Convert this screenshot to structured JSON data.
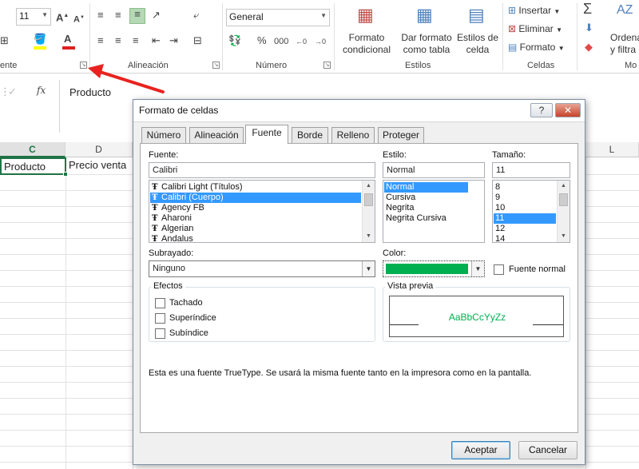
{
  "ribbon": {
    "font_size_value": "11",
    "number_format_value": "General",
    "number_buttons": [
      "%",
      "000"
    ],
    "group_labels": {
      "fuente": "ente",
      "alineacion": "Alineación",
      "numero": "Número",
      "estilos": "Estilos",
      "celdas": "Celdas",
      "modificar": "Mo"
    },
    "styles_buttons": [
      {
        "line1": "Formato",
        "line2": "condicional"
      },
      {
        "line1": "Dar formato",
        "line2": "como tabla"
      },
      {
        "line1": "Estilos de",
        "line2": "celda"
      }
    ],
    "cells_buttons": [
      "Insertar",
      "Eliminar",
      "Formato"
    ],
    "edit_buttons": {
      "line1": "Ordena",
      "line2": "y filtra"
    }
  },
  "formula_bar": {
    "cell_value": "Producto",
    "fx_label": "fx"
  },
  "grid": {
    "columns": [
      "C",
      "D",
      "L"
    ],
    "cells": {
      "c1": "Producto",
      "d1": "Precio venta"
    }
  },
  "dialog": {
    "title": "Formato de celdas",
    "help_label": "?",
    "close_label": "✕",
    "tabs": [
      "Número",
      "Alineación",
      "Fuente",
      "Borde",
      "Relleno",
      "Proteger"
    ],
    "active_tab": "Fuente",
    "font": {
      "label": "Fuente:",
      "value": "Calibri",
      "items": [
        "Calibri Light (Títulos)",
        "Calibri (Cuerpo)",
        "Agency FB",
        "Aharoni",
        "Algerian",
        "Andalus"
      ],
      "selected_index": 1
    },
    "style": {
      "label": "Estilo:",
      "value": "Normal",
      "items": [
        "Normal",
        "Cursiva",
        "Negrita",
        "Negrita Cursiva"
      ],
      "selected_index": 0
    },
    "size": {
      "label": "Tamaño:",
      "value": "11",
      "items": [
        "8",
        "9",
        "10",
        "11",
        "12",
        "14"
      ],
      "selected_index": 3
    },
    "underline": {
      "label": "Subrayado:",
      "value": "Ninguno"
    },
    "color": {
      "label": "Color:",
      "value_hex": "#00b050"
    },
    "normal_font": {
      "label": "Fuente normal",
      "checked": false
    },
    "effects": {
      "legend": "Efectos",
      "items": [
        {
          "label": "Tachado",
          "checked": false
        },
        {
          "label": "Superíndice",
          "checked": false
        },
        {
          "label": "Subíndice",
          "checked": false
        }
      ]
    },
    "preview": {
      "legend": "Vista previa",
      "sample": "AaBbCcYyZz",
      "sample_color": "#00b050"
    },
    "info_text": "Esta es una fuente TrueType. Se usará la misma fuente tanto en la impresora como en la pantalla.",
    "ok_label": "Aceptar",
    "cancel_label": "Cancelar"
  },
  "colors": {
    "excel_green": "#217346",
    "selection_blue": "#3399ff",
    "arrow_red": "#e8231f"
  }
}
